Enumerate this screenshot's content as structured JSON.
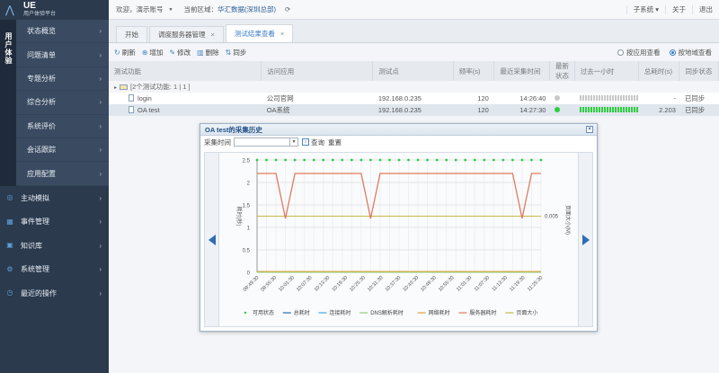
{
  "sidebar": {
    "logo_title": "UE",
    "logo_subtitle": "用户体验平台",
    "vertical_tab": "用户体验",
    "sub_items": [
      "状态概览",
      "问题清单",
      "专题分析",
      "综合分析",
      "系统评价",
      "会话跟踪",
      "应用配置"
    ],
    "main_items": [
      {
        "label": "主动模拟",
        "icon": "target-icon"
      },
      {
        "label": "事件管理",
        "icon": "calendar-icon"
      },
      {
        "label": "知识库",
        "icon": "book-icon"
      },
      {
        "label": "系统管理",
        "icon": "gear-icon"
      },
      {
        "label": "最近的操作",
        "icon": "clock-icon"
      }
    ]
  },
  "topbar": {
    "welcome": "欢迎，演示账号",
    "dropdown_caret": "▼",
    "region_label": "当前区域：",
    "region_value": "华汇数据(深圳总部)",
    "right_items": [
      "子系统 ▾",
      "关于",
      "退出"
    ]
  },
  "tabs": [
    {
      "label": "开始",
      "closable": false
    },
    {
      "label": "调度服务器管理",
      "closable": true
    },
    {
      "label": "测试结果查看",
      "closable": true
    }
  ],
  "toolbar": {
    "buttons": [
      "刷新",
      "增加",
      "修改",
      "删除",
      "同步"
    ],
    "view_by_app": "按应用查看",
    "view_by_region": "按地域查看"
  },
  "grid": {
    "columns": [
      "测试功能",
      "访问应用",
      "测试点",
      "频率(s)",
      "最近采集时间",
      "最新状态",
      "过去一小时",
      "总耗时(s)",
      "同步状态"
    ],
    "group_label": "[2个测试功能: 1 | 1 ]",
    "rows": [
      {
        "name": "login",
        "app": "公司官网",
        "point": "192.168.0.235",
        "freq": "120",
        "time": "14:26:40",
        "status_color": "#c8c8c8",
        "hour": 0.0,
        "total": "-",
        "sync": "已同步"
      },
      {
        "name": "OA test",
        "app": "OA系统",
        "point": "192.168.0.235",
        "freq": "120",
        "time": "14:27:30",
        "status_color": "#2ecc40",
        "hour": 1.0,
        "total": "2.203",
        "sync": "已同步"
      }
    ]
  },
  "dialog": {
    "title": "OA test的采集历史",
    "close": "×",
    "time_label": "采集时间",
    "select_caret": "▼",
    "query": "查询",
    "reset": "重置"
  },
  "chart_data": {
    "type": "line",
    "ylabel": "耗时(秒)",
    "ylabel_right": "页面大小(M)",
    "y_ticks": [
      "0",
      "0.5",
      "1",
      "1.5",
      "2",
      "2.5"
    ],
    "ylim": [
      0,
      2.5
    ],
    "y_right_tick": "0.005",
    "categories": [
      "09:49:30",
      "09:55:30",
      "10:01:30",
      "10:07:30",
      "10:13:30",
      "10:19:30",
      "10:25:30",
      "10:31:30",
      "10:37:30",
      "10:43:30",
      "10:49:30",
      "10:55:30",
      "11:01:30",
      "11:07:30",
      "11:13:30",
      "11:19:30",
      "11:25:30"
    ],
    "legend": [
      {
        "name": "可用状态",
        "color": "#2ecc40"
      },
      {
        "name": "总耗时",
        "color": "#1f6fb2"
      },
      {
        "name": "连接耗时",
        "color": "#3fa9e0"
      },
      {
        "name": "DNS解析耗时",
        "color": "#8ed17a"
      },
      {
        "name": "网络耗时",
        "color": "#e8a23c"
      },
      {
        "name": "服务器耗时",
        "color": "#e07a5f"
      },
      {
        "name": "页面大小",
        "color": "#c9b84a"
      }
    ],
    "availability_y": 2.5,
    "server_time": [
      2.2,
      2.2,
      2.2,
      1.2,
      2.2,
      2.2,
      2.2,
      2.2,
      2.2,
      2.2,
      2.2,
      2.2,
      1.2,
      2.2,
      2.2,
      2.2,
      2.2,
      2.2,
      2.2,
      2.2,
      2.2,
      2.2,
      2.2,
      2.2,
      2.2,
      2.2,
      2.2,
      2.2,
      1.2,
      2.2,
      2.2
    ],
    "page_size_y": 1.25,
    "network_y": 0.02,
    "dns_y": 0.0
  }
}
